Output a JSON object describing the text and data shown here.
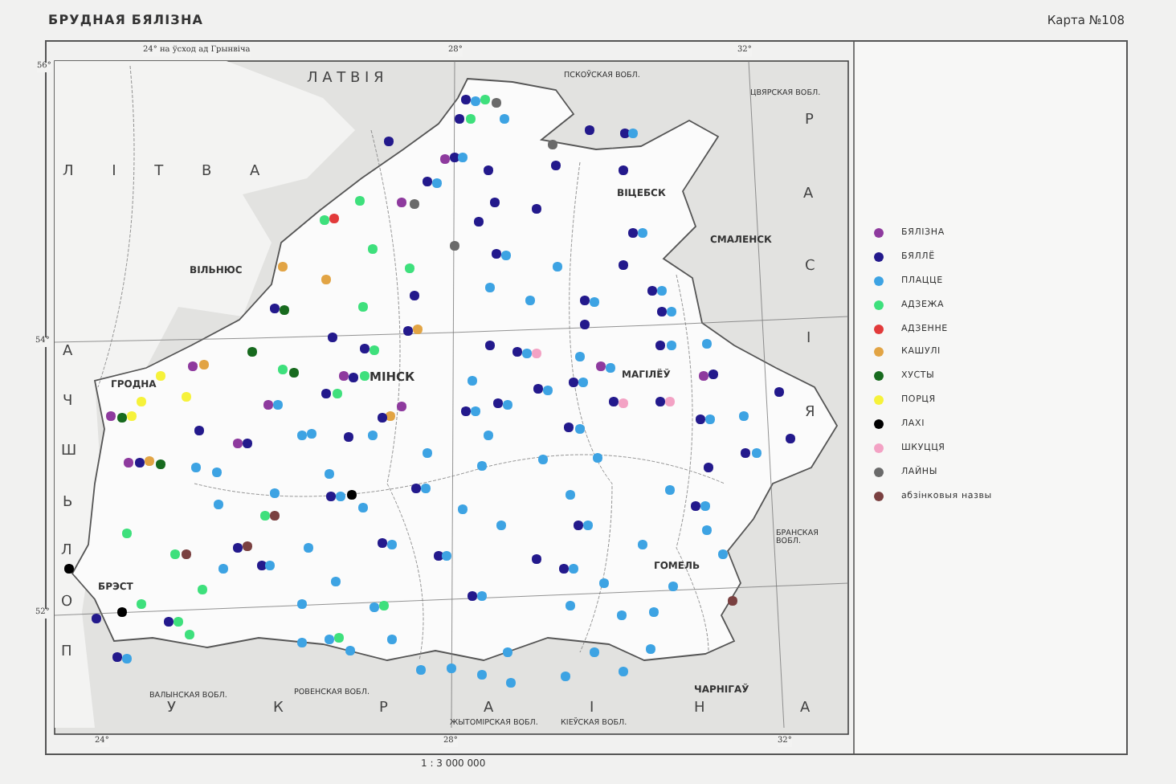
{
  "header": {
    "title": "БРУДНАЯ БЯЛІЗНА",
    "map_number": "Карта №108"
  },
  "map": {
    "labels": [
      {
        "text": "24° на ўсход ад Грынвіча",
        "kind": "degree"
      },
      {
        "text": "28°",
        "kind": "degree"
      },
      {
        "text": "32°",
        "kind": "degree"
      },
      {
        "text": "56°",
        "kind": "degree"
      },
      {
        "text": "54°",
        "kind": "degree"
      },
      {
        "text": "52°",
        "kind": "degree"
      },
      {
        "text": "Л А Т В І Я",
        "kind": "country"
      },
      {
        "text": "ПСКОЎСКАЯ ВОБЛ.",
        "kind": "region"
      },
      {
        "text": "ЦВЯРСКАЯ ВОБЛ.",
        "kind": "region"
      },
      {
        "text": "Л І Т В А",
        "kind": "country"
      },
      {
        "text": "ВІЛЬНЮС",
        "kind": "city"
      },
      {
        "text": "ВІЦЕБСК",
        "kind": "city"
      },
      {
        "text": "СМАЛЕНСК",
        "kind": "city"
      },
      {
        "text": "Р",
        "kind": "country"
      },
      {
        "text": "А",
        "kind": "country"
      },
      {
        "text": "С",
        "kind": "country"
      },
      {
        "text": "І",
        "kind": "country"
      },
      {
        "text": "Я",
        "kind": "country"
      },
      {
        "text": "ГРОДНА",
        "kind": "city"
      },
      {
        "text": "МІНСК",
        "kind": "capital"
      },
      {
        "text": "МАГІЛЁЎ",
        "kind": "city"
      },
      {
        "text": "А",
        "kind": "country"
      },
      {
        "text": "Ч",
        "kind": "country"
      },
      {
        "text": "Ш",
        "kind": "country"
      },
      {
        "text": "Ь",
        "kind": "country"
      },
      {
        "text": "Л",
        "kind": "country"
      },
      {
        "text": "О",
        "kind": "country"
      },
      {
        "text": "П",
        "kind": "country"
      },
      {
        "text": "БРАНСКАЯ ВОБЛ.",
        "kind": "region"
      },
      {
        "text": "ГОМЕЛЬ",
        "kind": "city"
      },
      {
        "text": "БРЭСТ",
        "kind": "city"
      },
      {
        "text": "ЧАРНІГАЎ",
        "kind": "city"
      },
      {
        "text": "ВАЛЫНСКАЯ ВОБЛ.",
        "kind": "region"
      },
      {
        "text": "РОВЕНСКАЯ ВОБЛ.",
        "kind": "region"
      },
      {
        "text": "ЖЫТОМІРСКАЯ ВОБЛ.",
        "kind": "region"
      },
      {
        "text": "КІЕЎСКАЯ ВОБЛ.",
        "kind": "region"
      },
      {
        "text": "У",
        "kind": "country"
      },
      {
        "text": "К",
        "kind": "country"
      },
      {
        "text": "Р",
        "kind": "country"
      },
      {
        "text": "А",
        "kind": "country"
      },
      {
        "text": "І",
        "kind": "country"
      },
      {
        "text": "Н",
        "kind": "country"
      },
      {
        "text": "А",
        "kind": "country"
      },
      {
        "text": "24°",
        "kind": "degree"
      },
      {
        "text": "28°",
        "kind": "degree"
      },
      {
        "text": "32°",
        "kind": "degree"
      }
    ],
    "scale": "1 : 3 000 000"
  },
  "legend": [
    {
      "label": "БЯЛІЗНА",
      "color": "#8e3a9e"
    },
    {
      "label": "БЯЛЛЁ",
      "color": "#23198c"
    },
    {
      "label": "ПЛАЦЦЕ",
      "color": "#3da3e3"
    },
    {
      "label": "АДЗЕЖА",
      "color": "#3ee07c"
    },
    {
      "label": "АДЗЕННЕ",
      "color": "#e23a3a"
    },
    {
      "label": "КАШУЛІ",
      "color": "#e2a444"
    },
    {
      "label": "ХУСТЫ",
      "color": "#176a1e"
    },
    {
      "label": "ПОРЦЯ",
      "color": "#f6f23a"
    },
    {
      "label": "ЛАХІ",
      "color": "#000000"
    },
    {
      "label": "ШКУЦЦЯ",
      "color": "#f3a2c4"
    },
    {
      "label": "ЛАЙНЫ",
      "color": "#6a6a6a"
    },
    {
      "label": "абзінковыя назвы",
      "color": "#7a4040"
    }
  ]
}
